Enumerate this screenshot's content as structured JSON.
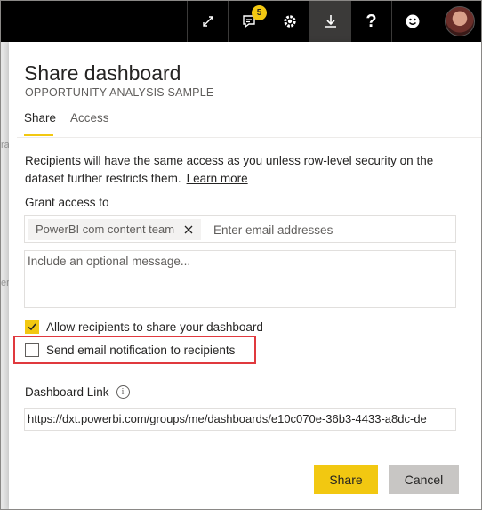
{
  "topbar": {
    "icons": [
      "expand-icon",
      "notifications-icon",
      "settings-icon",
      "download-icon",
      "help-icon",
      "feedback-icon"
    ],
    "notification_count": "5",
    "accent_color": "#f2c811"
  },
  "background": {
    "fragment_1": "ra",
    "fragment_2": "er"
  },
  "dialog": {
    "title": "Share dashboard",
    "subtitle": "OPPORTUNITY ANALYSIS SAMPLE",
    "tabs": [
      {
        "label": "Share",
        "active": true
      },
      {
        "label": "Access",
        "active": false
      }
    ],
    "description": "Recipients will have the same access as you unless row-level security on the dataset further restricts them.",
    "learn_more": "Learn more",
    "grant_label": "Grant access to",
    "recipient_chip": "PowerBI com content team",
    "email_placeholder": "Enter email addresses",
    "message_placeholder": "Include an optional message...",
    "allow_share_label": "Allow recipients to share your dashboard",
    "allow_share_checked": true,
    "send_email_label": "Send email notification to recipients",
    "send_email_checked": false,
    "link_label": "Dashboard Link",
    "link_value": "https://dxt.powerbi.com/groups/me/dashboards/e10c070e-36b3-4433-a8dc-de",
    "share_button": "Share",
    "cancel_button": "Cancel"
  }
}
